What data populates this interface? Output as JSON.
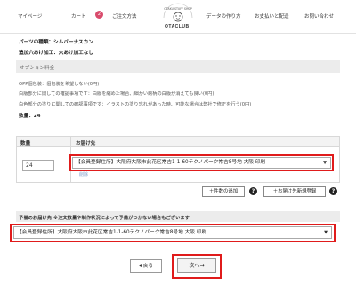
{
  "header": {
    "nav": {
      "mypage": "マイページ",
      "cart": "カート",
      "cart_count": "2",
      "order_method": "ご注文方法",
      "data_guide": "データの作り方",
      "payment_shipping": "お支払いと配送",
      "contact": "お問い合わせ"
    },
    "logo": {
      "text": "OTACLUB",
      "arc_text": "OTAKU STUFF SHOP"
    }
  },
  "summary": {
    "parts_type": "パーツの種類：シルバーナスカン",
    "hole_option": "追加穴あけ加工：穴あけ加工なし",
    "option_fee_label": "オプション料金",
    "opp_line": "OPP個包装：個包装を希望しない(0円)",
    "white_confirm_line": "白版部分に関しての確認事項です：白版を縮めた場合、細かい絵柄の白版が消えても良い(0円)",
    "white_paint_line": "白色部分の塗りに関しての確認事項です：イラストの塗り忘れがあった時、可能な場合は弊社で修正を行う(0円)",
    "count_line": "数量：24"
  },
  "qty_table": {
    "col_quantity": "数量",
    "col_destination": "お届け先",
    "quantity_value": "24",
    "destination_selected": "【会員登録住所】大阪府大阪市此花区常吉1-1-60テクノパーク常吉8号地 大阪 印刷",
    "delete_link": "削除"
  },
  "actions": {
    "add_quantity": "＋件数の追加",
    "add_destination": "＋お届け先新規登録"
  },
  "bulk": {
    "notice": "予備のお届け先 ※注文数量や制作状況によって予備がつかない場合もございます",
    "destination_selected": "【会員登録住所】大阪府大阪市此花区常吉1-1-60テクノパーク常吉8号地 大阪 印刷"
  },
  "nav_buttons": {
    "back": "◂ 戻る",
    "next": "次へ→"
  },
  "colors": {
    "highlight": "#e01b1b",
    "badge": "#d94b6c",
    "bar_bg": "#ececec"
  }
}
